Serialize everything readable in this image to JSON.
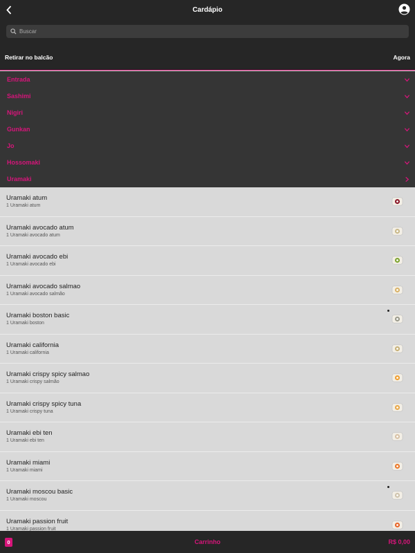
{
  "header": {
    "title": "Cardápio",
    "back_icon": "chevron-left-icon",
    "account_icon": "account-circle-icon"
  },
  "search": {
    "placeholder": "Buscar",
    "value": ""
  },
  "pickup": {
    "mode": "Retirar no balcão",
    "time": "Agora"
  },
  "categories": [
    {
      "label": "Entrada",
      "icon": "chevron-down-icon"
    },
    {
      "label": "Sashimi",
      "icon": "chevron-down-icon"
    },
    {
      "label": "Nigiri",
      "icon": "chevron-down-icon"
    },
    {
      "label": "Gunkan",
      "icon": "chevron-down-icon"
    },
    {
      "label": "Jo",
      "icon": "chevron-down-icon"
    },
    {
      "label": "Hossomaki",
      "icon": "chevron-down-icon"
    },
    {
      "label": "Uramaki",
      "icon": "chevron-right-icon"
    }
  ],
  "products": [
    {
      "name": "Uramaki atum",
      "desc": "1 Uramaki atum",
      "thumb_color": "#8b1a2a"
    },
    {
      "name": "Uramaki avocado atum",
      "desc": "1 Uramaki avocado atum",
      "thumb_color": "#c9b98a"
    },
    {
      "name": "Uramaki avocado ebi",
      "desc": "1 Uramaki avocado ebi",
      "thumb_color": "#7fa532"
    },
    {
      "name": "Uramaki avocado salmao",
      "desc": "1 Uramaki avocado salmão",
      "thumb_color": "#d9b36a"
    },
    {
      "name": "Uramaki boston basic",
      "desc": "1 Uramaki boston",
      "thumb_color": "#9b9b8c"
    },
    {
      "name": "Uramaki california",
      "desc": "1 Uramaki california",
      "thumb_color": "#c7b27a"
    },
    {
      "name": "Uramaki crispy spicy salmao",
      "desc": "1 Uramaki crispy salmão",
      "thumb_color": "#f0a033"
    },
    {
      "name": "Uramaki crispy spicy tuna",
      "desc": "1 Uramaki crispy tuna",
      "thumb_color": "#e9a84a"
    },
    {
      "name": "Uramaki ebi ten",
      "desc": "1 Uramaki ebi ten",
      "thumb_color": "#d8c2a6"
    },
    {
      "name": "Uramaki miami",
      "desc": "1 Uramaki miami",
      "thumb_color": "#ec7a2b"
    },
    {
      "name": "Uramaki moscou basic",
      "desc": "1 Uramaki moscou",
      "thumb_color": "#cfc3ad"
    },
    {
      "name": "Uramaki passion fruit",
      "desc": "1 Uramaki passion fruit",
      "thumb_color": "#e8662a"
    }
  ],
  "cart": {
    "count": "0",
    "label": "Carrinho",
    "total": "R$ 0,00"
  },
  "colors": {
    "accent": "#d6157a",
    "dark": "#262626",
    "panel": "#353535",
    "list_bg": "#d9d9d9"
  }
}
